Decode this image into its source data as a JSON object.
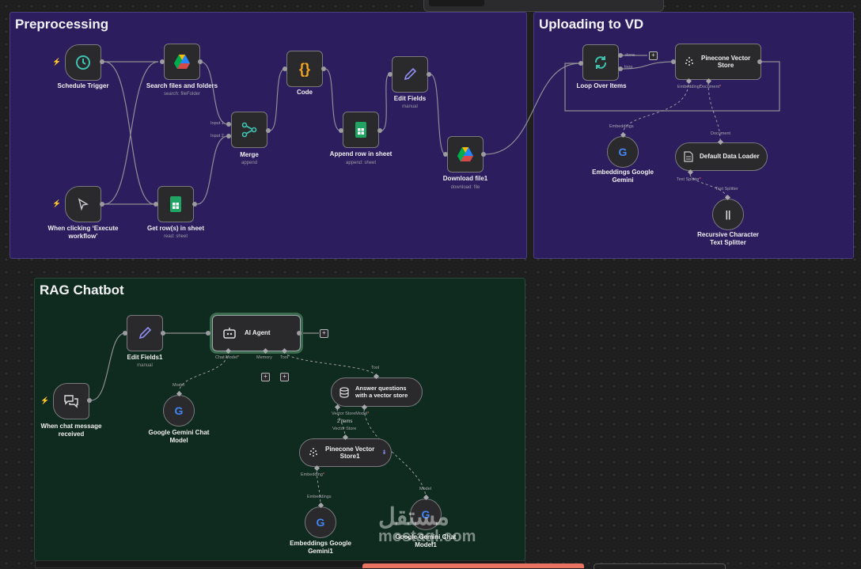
{
  "sections": {
    "preprocessing": "Preprocessing",
    "uploading": "Uploading to VD",
    "rag": "RAG Chatbot"
  },
  "nodes": {
    "schedule_trigger": {
      "title": "Schedule Trigger"
    },
    "search_files": {
      "title": "Search files and folders",
      "sub": "search: fileFolder"
    },
    "code": {
      "title": "Code"
    },
    "edit_fields": {
      "title": "Edit Fields",
      "sub": "manual"
    },
    "merge": {
      "title": "Merge",
      "sub": "append",
      "input1": "Input 1",
      "input2": "Input 2"
    },
    "append_row": {
      "title": "Append row in sheet",
      "sub": "append: sheet"
    },
    "download_file": {
      "title": "Download file1",
      "sub": "download: file"
    },
    "manual_trigger": {
      "title_l1": "When clicking ‘Execute",
      "title_l2": "workflow’"
    },
    "get_rows": {
      "title": "Get row(s) in sheet",
      "sub": "read: sheet"
    },
    "loop": {
      "title": "Loop Over Items",
      "done": "done",
      "loop": "loop"
    },
    "pinecone": {
      "title_l1": "Pinecone Vector",
      "title_l2": "Store",
      "embedding": "Embedding",
      "document": "Document",
      "star": "*"
    },
    "embeddings_google": {
      "title_l1": "Embeddings Google",
      "title_l2": "Gemini",
      "port": "Embeddings"
    },
    "default_loader": {
      "title": "Default Data Loader",
      "port": "Document",
      "text_splitter": "Text Splitter",
      "star": "*"
    },
    "recursive": {
      "title_l1": "Recursive Character",
      "title_l2": "Text Splitter",
      "port": "Text Splitter"
    },
    "edit_fields1": {
      "title": "Edit Fields1",
      "sub": "manual"
    },
    "ai_agent": {
      "title": "AI Agent",
      "chat_model": "Chat Model",
      "memory": "Memory",
      "tool": "Tool",
      "star": "*"
    },
    "chat_trigger": {
      "title_l1": "When chat message",
      "title_l2": "received"
    },
    "gemini_chat": {
      "title_l1": "Google Gemini Chat",
      "title_l2": "Model",
      "port": "Model"
    },
    "answer_q": {
      "title_l1": "Answer questions",
      "title_l2": "with a vector store",
      "port": "Tool",
      "vector_store": "Vector Store",
      "model": "Model",
      "star": "*",
      "items": "2 items"
    },
    "pinecone1": {
      "title_l1": "Pinecone Vector",
      "title_l2": "Store1",
      "port": "Vector Store",
      "embedding": "Embedding",
      "star": "*"
    },
    "embeddings1": {
      "title_l1": "Embeddings Google",
      "title_l2": "Gemini1",
      "port": "Embeddings"
    },
    "gemini_chat1": {
      "title_l1": "Google Gemini Chat",
      "title_l2": "Model1",
      "port": "Model"
    }
  },
  "watermark": {
    "arabic": "مستقل",
    "latin": "mostaql.com"
  },
  "colors": {
    "preprocessing_bg": "#2b1d5e",
    "rag_bg": "#0f2a1e",
    "accent": "#ff6d5a"
  },
  "icons": {
    "schedule_trigger": "clock-icon",
    "search_files": "google-drive-icon",
    "code": "code-braces-icon",
    "edit_fields": "pencil-icon",
    "merge": "merge-icon",
    "append_row": "google-sheets-icon",
    "download_file": "google-drive-icon",
    "manual_trigger": "cursor-click-icon",
    "get_rows": "google-sheets-icon",
    "loop": "loop-arrows-icon",
    "pinecone": "pinecone-icon",
    "embeddings_google": "google-g-icon",
    "default_loader": "document-icon",
    "recursive": "pause-bars-icon",
    "edit_fields1": "pencil-icon",
    "ai_agent": "robot-icon",
    "chat_trigger": "chat-bubbles-icon",
    "gemini_chat": "google-g-icon",
    "answer_q": "database-icon",
    "pinecone1": "pinecone-icon",
    "embeddings1": "google-g-icon",
    "gemini_chat1": "google-g-icon"
  }
}
